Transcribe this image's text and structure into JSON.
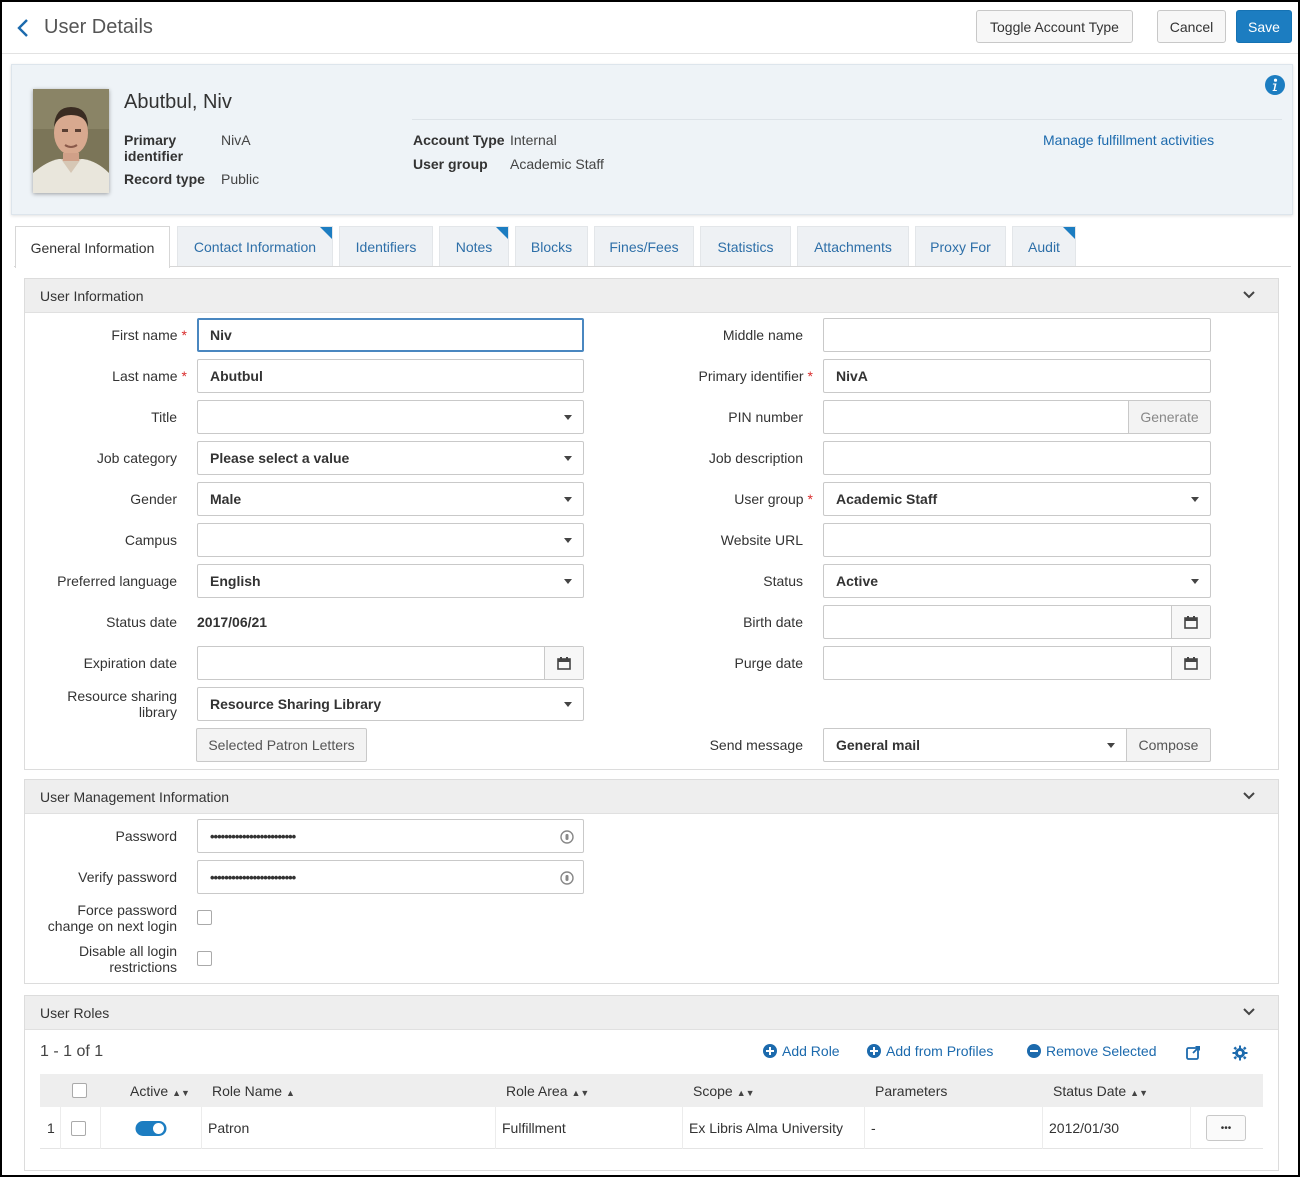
{
  "header": {
    "title": "User Details",
    "toggle_label": "Toggle Account Type",
    "cancel_label": "Cancel",
    "save_label": "Save"
  },
  "card": {
    "name": "Abutbul, Niv",
    "primary_identifier_label": "Primary identifier",
    "primary_identifier_value": "NivA",
    "record_type_label": "Record type",
    "record_type_value": "Public",
    "account_type_label": "Account Type",
    "account_type_value": "Internal",
    "user_group_label": "User group",
    "user_group_value": "Academic Staff",
    "manage_link": "Manage fulfillment activities"
  },
  "tabs": [
    {
      "label": "General Information"
    },
    {
      "label": "Contact Information"
    },
    {
      "label": "Identifiers"
    },
    {
      "label": "Notes"
    },
    {
      "label": "Blocks"
    },
    {
      "label": "Fines/Fees"
    },
    {
      "label": "Statistics"
    },
    {
      "label": "Attachments"
    },
    {
      "label": "Proxy For"
    },
    {
      "label": "Audit"
    }
  ],
  "user_info": {
    "title": "User Information",
    "first_name_label": "First name",
    "first_name_value": "Niv",
    "last_name_label": "Last name",
    "last_name_value": "Abutbul",
    "title_label": "Title",
    "title_value": "",
    "job_category_label": "Job category",
    "job_category_value": "Please select a value",
    "gender_label": "Gender",
    "gender_value": "Male",
    "campus_label": "Campus",
    "campus_value": "",
    "pref_lang_label": "Preferred language",
    "pref_lang_value": "English",
    "status_date_label": "Status date",
    "status_date_value": "2017/06/21",
    "expiration_label": "Expiration date",
    "expiration_value": "",
    "rs_library_label_1": "Resource sharing",
    "rs_library_label_2": "library",
    "rs_library_value": "Resource Sharing Library",
    "patron_letters_label": "Selected Patron Letters",
    "middle_name_label": "Middle name",
    "middle_name_value": "",
    "primary_id_label": "Primary identifier",
    "primary_id_value": "NivA",
    "pin_label": "PIN number",
    "pin_value": "",
    "generate_label": "Generate",
    "job_desc_label": "Job description",
    "job_desc_value": "",
    "user_group_label": "User group",
    "user_group_value": "Academic Staff",
    "website_label": "Website URL",
    "website_value": "",
    "status_label": "Status",
    "status_value": "Active",
    "birth_label": "Birth date",
    "birth_value": "",
    "purge_label": "Purge date",
    "purge_value": "",
    "send_message_label": "Send message",
    "send_message_value": "General mail",
    "compose_label": "Compose"
  },
  "mgmt": {
    "title": "User Management Information",
    "password_label": "Password",
    "password_value": "••••••••••••••••••••••••",
    "verify_label": "Verify password",
    "verify_value": "••••••••••••••••••••••••",
    "force_label_1": "Force password",
    "force_label_2": "change on next login",
    "disable_label_1": "Disable all login",
    "disable_label_2": "restrictions"
  },
  "roles": {
    "title": "User Roles",
    "count": "1 - 1 of 1",
    "add_role": "Add Role",
    "add_profiles": "Add from Profiles",
    "remove_selected": "Remove Selected",
    "columns": {
      "active": "Active",
      "role_name": "Role Name",
      "role_area": "Role Area",
      "scope": "Scope",
      "parameters": "Parameters",
      "status_date": "Status Date"
    },
    "rows": [
      {
        "num": "1",
        "active": true,
        "role_name": "Patron",
        "role_area": "Fulfillment",
        "scope": "Ex Libris Alma University",
        "parameters": "-",
        "status_date": "2012/01/30",
        "more": "•••"
      }
    ]
  },
  "colors": {
    "accent": "#1c7dc1",
    "link": "#1c6aad",
    "required": "#d92b2b"
  }
}
